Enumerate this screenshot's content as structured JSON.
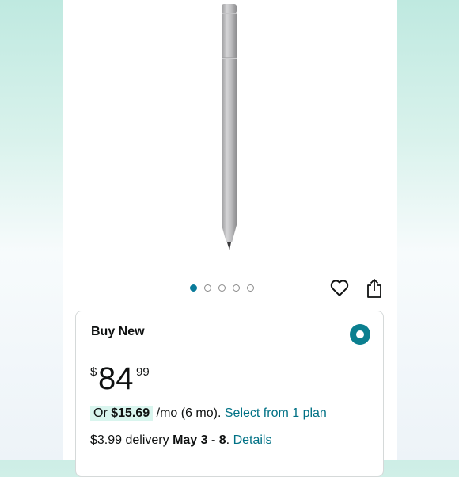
{
  "product": {
    "image_name": "surface-pen-silver"
  },
  "carousel": {
    "count": 5,
    "active_index": 0
  },
  "actions": {
    "wishlist_icon": "heart-icon",
    "share_icon": "share-icon"
  },
  "buy_box": {
    "title": "Buy New",
    "price_symbol": "$",
    "price_whole": "84",
    "price_fraction": "99",
    "installment_prefix": "Or",
    "installment_amount": "$15.69",
    "installment_terms": "/mo (6 mo).",
    "installment_link": "Select from 1 plan",
    "delivery_fee": "$3.99 delivery",
    "delivery_dates": "May 3 - 8",
    "delivery_sep": ".",
    "delivery_link": "Details"
  },
  "colors": {
    "accent": "#007185",
    "radio": "#0a7f8f",
    "highlight": "#d9f5ee"
  }
}
